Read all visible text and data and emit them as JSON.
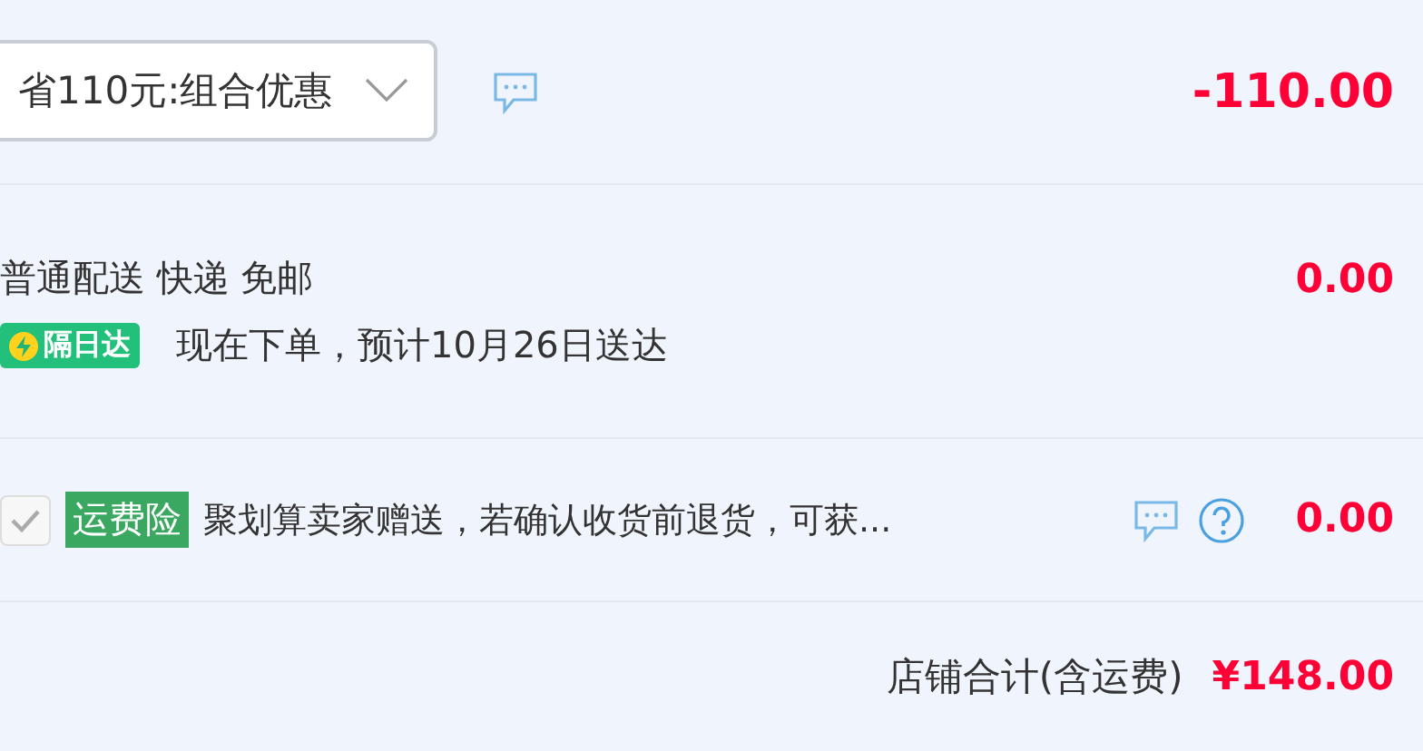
{
  "discount": {
    "dropdown": "省110元:组合优惠",
    "amount": "-110.00"
  },
  "delivery": {
    "method": "普通配送 快递 免邮",
    "badge": "隔日达",
    "estimate": "现在下单，预计10月26日送达",
    "amount": "0.00"
  },
  "insurance": {
    "checked": true,
    "tag": "运费险",
    "text": "聚划算卖家赠送，若确认收货前退货，可获...",
    "amount": "0.00"
  },
  "total": {
    "label": "店铺合计(含运费)",
    "amount": "¥148.00"
  }
}
